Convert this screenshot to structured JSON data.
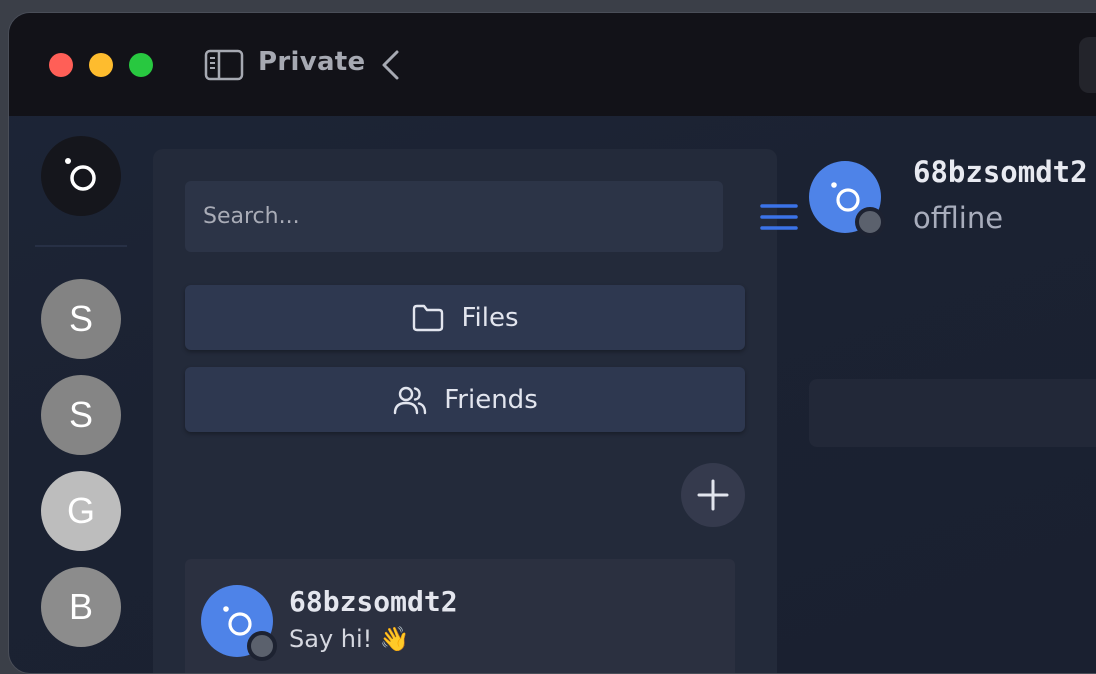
{
  "window": {
    "title": "Private"
  },
  "rail": {
    "avatars": [
      {
        "letter": "S",
        "color": "#838383"
      },
      {
        "letter": "S",
        "color": "#858585"
      },
      {
        "letter": "G",
        "color": "#bdbdbd"
      },
      {
        "letter": "B",
        "color": "#8c8c8c"
      }
    ]
  },
  "panel": {
    "search_placeholder": "Search...",
    "files_label": "Files",
    "friends_label": "Friends"
  },
  "chat_list": [
    {
      "name": "68bzsomdt2",
      "preview": "Say hi! 👋",
      "status": "offline"
    }
  ],
  "conversation": {
    "name": "68bzsomdt2",
    "status": "offline"
  },
  "icons": {
    "sidebar_toggle": "sidebar-toggle-icon",
    "back": "chevron-left-icon",
    "menu": "hamburger-menu-icon",
    "files": "folder-icon",
    "friends": "users-icon",
    "add": "plus-icon"
  },
  "colors": {
    "accent": "#3b73e8",
    "avatar_blue": "#4e83e8",
    "offline_dot": "#5b616d"
  }
}
